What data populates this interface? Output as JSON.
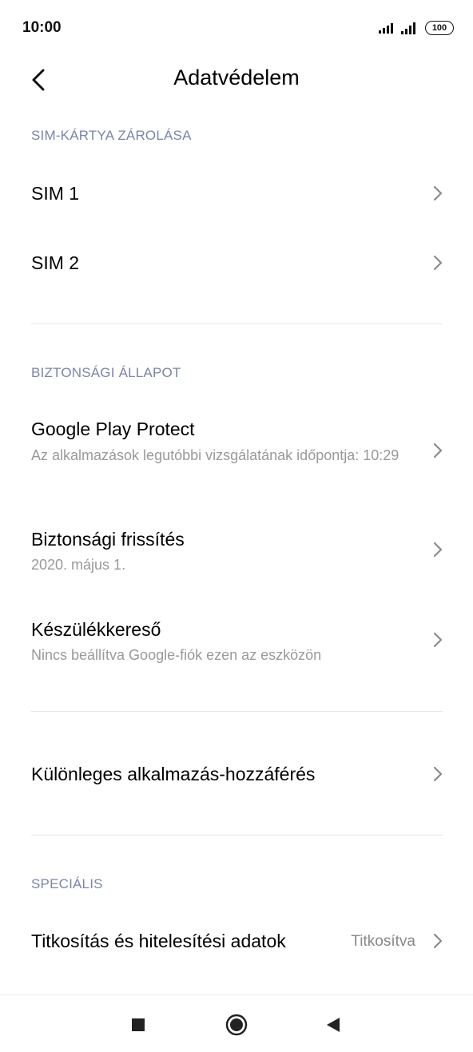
{
  "status_bar": {
    "time": "10:00",
    "battery": "100",
    "icons": [
      "signal-icon",
      "signal-icon",
      "battery-icon"
    ]
  },
  "header": {
    "title": "Adatvédelem",
    "back_icon": "chevron-left-icon"
  },
  "sections": {
    "sim_lock": {
      "header": "SIM-KÁRTYA ZÁROLÁSA",
      "items": [
        {
          "title": "SIM 1"
        },
        {
          "title": "SIM 2"
        }
      ]
    },
    "security_status": {
      "header": "BIZTONSÁGI ÁLLAPOT",
      "items": [
        {
          "title": "Google Play Protect",
          "subtitle": "Az alkalmazások legutóbbi vizsgálatának időpontja: 10:29"
        },
        {
          "title": "Biztonsági frissítés",
          "subtitle": "2020. május 1."
        },
        {
          "title": "Készülékkereső",
          "subtitle": "Nincs beállítva Google-fiók ezen az eszközön"
        }
      ]
    },
    "special_access": {
      "items": [
        {
          "title": "Különleges alkalmazás-hozzáférés"
        }
      ]
    },
    "special": {
      "header": "SPECIÁLIS",
      "items": [
        {
          "title": "Titkosítás és hitelesítési adatok",
          "value": "Titkosítva"
        }
      ]
    }
  },
  "nav_bar": {
    "icons": [
      "recents-square-icon",
      "home-circle-icon",
      "back-triangle-icon"
    ]
  },
  "colors": {
    "section_header": "#7a85a8",
    "subtitle": "#999999",
    "chevron": "#8a8a8a",
    "divider": "#e6e6e6"
  }
}
